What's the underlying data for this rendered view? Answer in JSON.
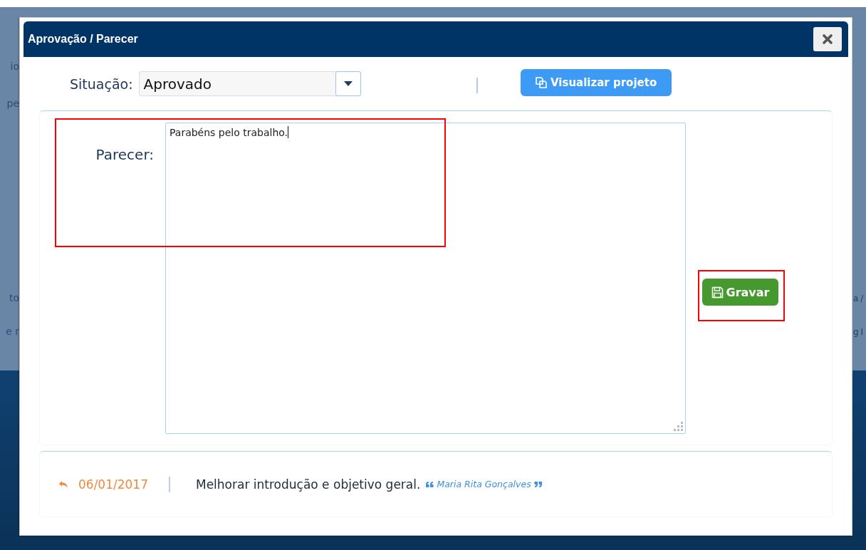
{
  "background": {
    "left_fragments": [
      "io",
      "pe",
      "to",
      "e r"
    ],
    "right_fragments": [
      "a /",
      "g I"
    ]
  },
  "dialog": {
    "title": "Aprovação / Parecer"
  },
  "form": {
    "situacao": {
      "label": "Situação:",
      "value": "Aprovado"
    },
    "view_button": "Visualizar projeto",
    "parecer": {
      "label": "Parecer:",
      "value": "Parabéns pelo trabalho."
    },
    "save_button": "Gravar"
  },
  "history": [
    {
      "date": "06/01/2017",
      "comment": "Melhorar introdução e objetivo geral.",
      "author": "Maria Rita Gonçalves"
    }
  ]
}
